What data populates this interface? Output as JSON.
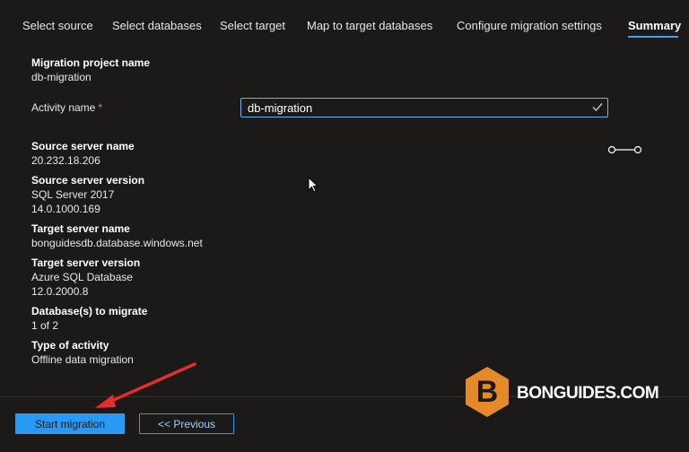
{
  "tabs": [
    {
      "label": "Select source"
    },
    {
      "label": "Select databases"
    },
    {
      "label": "Select target"
    },
    {
      "label": "Map to target databases"
    },
    {
      "label": "Configure migration settings"
    },
    {
      "label": "Summary"
    }
  ],
  "summary": {
    "project_name_label": "Migration project name",
    "project_name_value": "db-migration",
    "activity_label": "Activity name",
    "required_mark": "*",
    "activity_value": "db-migration",
    "source_server_name_label": "Source server name",
    "source_server_name_value": "20.232.18.206",
    "source_server_version_label": "Source server version",
    "source_server_version_line1": "SQL Server 2017",
    "source_server_version_line2": "14.0.1000.169",
    "target_server_name_label": "Target server name",
    "target_server_name_value": "bonguidesdb.database.windows.net",
    "target_server_version_label": "Target server version",
    "target_server_version_line1": "Azure SQL Database",
    "target_server_version_line2": "12.0.2000.8",
    "databases_label": "Database(s) to migrate",
    "databases_value": "1 of 2",
    "activity_type_label": "Type of activity",
    "activity_type_value": "Offline data migration"
  },
  "footer": {
    "start_label": "Start migration",
    "previous_label": "<< Previous"
  },
  "watermark": {
    "text": "BONGUIDES.COM",
    "letter": "B"
  },
  "colors": {
    "accent": "#2899f5",
    "hex_logo": "#e58a2a",
    "arrow": "#e52d2d",
    "required": "#f1707b"
  }
}
